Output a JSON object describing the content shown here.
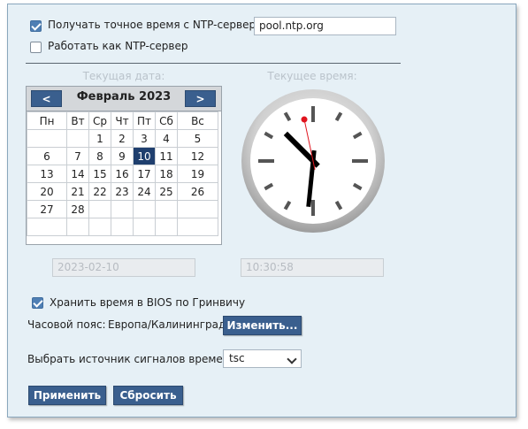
{
  "ntp": {
    "sync_label": "Получать точное время с NTP-сервера:",
    "sync_checked": true,
    "server_value": "pool.ntp.org",
    "serve_label": "Работать как NTP-сервер",
    "serve_checked": false
  },
  "date_section": {
    "heading": "Текущая дата:",
    "month_label": "Февраль 2023",
    "prev_label": "<",
    "next_label": ">",
    "weekdays": [
      "Пн",
      "Вт",
      "Ср",
      "Чт",
      "Пт",
      "Сб",
      "Вс"
    ],
    "weeks": [
      [
        "",
        "",
        "1",
        "2",
        "3",
        "4",
        "5"
      ],
      [
        "6",
        "7",
        "8",
        "9",
        "10",
        "11",
        "12"
      ],
      [
        "13",
        "14",
        "15",
        "16",
        "17",
        "18",
        "19"
      ],
      [
        "20",
        "21",
        "22",
        "23",
        "24",
        "25",
        "26"
      ],
      [
        "27",
        "28",
        "",
        "",
        "",
        "",
        ""
      ],
      [
        "",
        "",
        "",
        "",
        "",
        "",
        ""
      ]
    ],
    "selected_day": "10",
    "date_value": "2023-02-10"
  },
  "time_section": {
    "heading": "Текущее время:",
    "time_value": "10:30:58",
    "clock": {
      "hours": 10,
      "minutes": 30,
      "seconds": 58
    }
  },
  "bios": {
    "label": "Хранить время в BIOS по Гринвичу",
    "checked": true
  },
  "timezone": {
    "label": "Часовой пояс:",
    "value": "Европа/Калининград",
    "change_label": "Изменить..."
  },
  "time_source": {
    "label": "Выбрать источник сигналов времени:",
    "value": "tsc"
  },
  "actions": {
    "apply_label": "Применить",
    "reset_label": "Сбросить"
  },
  "colors": {
    "accent": "#3a5f8e",
    "panel_bg": "#e6f0f6",
    "selected_day_bg": "#1f3f6e",
    "second_hand": "#e0141e"
  }
}
